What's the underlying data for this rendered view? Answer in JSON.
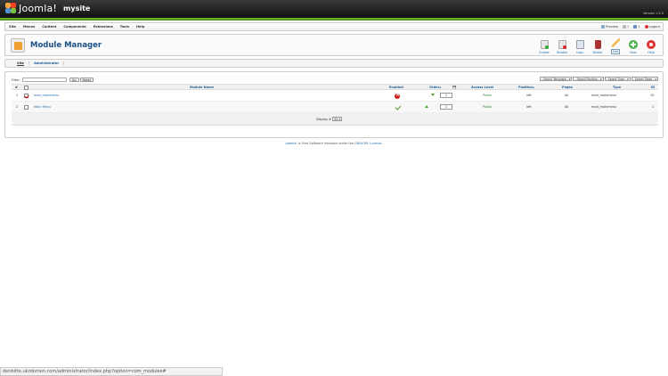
{
  "header": {
    "logo_text": "Joomla!",
    "site_name": "mysite",
    "version": "Version 1.5.0"
  },
  "menu": {
    "items": [
      "Site",
      "Menus",
      "Content",
      "Components",
      "Extensions",
      "Tools",
      "Help"
    ],
    "preview": "Preview",
    "messages": "0",
    "users": "1",
    "logout": "Logout"
  },
  "toolbar": {
    "title": "Module Manager",
    "buttons": [
      "Enable",
      "Disable",
      "Copy",
      "Delete",
      "Edit",
      "New",
      "Help"
    ]
  },
  "subnav": [
    "Site",
    "Administrator"
  ],
  "filter": {
    "label": "Filter:",
    "go": "Go",
    "reset": "Reset",
    "selects": [
      "- Select Template -",
      "- Select Position -",
      "- Select Type -",
      "- Select State -"
    ]
  },
  "table": {
    "headers": [
      "#",
      "Module Name",
      "Enabled",
      "Order",
      "Access Level",
      "Position",
      "Pages",
      "Type",
      "ID"
    ],
    "rows": [
      {
        "num": "1",
        "name": "mod_mainmenu",
        "enabled": false,
        "order": "1",
        "access": "Public",
        "position": "left",
        "pages": "All",
        "type": "mod_mainmenu",
        "id": "10"
      },
      {
        "num": "2",
        "name": "Main Menu",
        "enabled": true,
        "order": "2",
        "access": "Public",
        "position": "left",
        "pages": "All",
        "type": "mod_mainmenu",
        "id": "1"
      }
    ],
    "display_label": "Display #",
    "display_value": "20"
  },
  "footer": {
    "joomla": "Joomla!",
    "text": " is Free Software released under the ",
    "license": "GNU/GPL License."
  },
  "statusbar": {
    "url": "denbitte.ukrdomen.com/administrator/index.php?option=com_modules#"
  }
}
